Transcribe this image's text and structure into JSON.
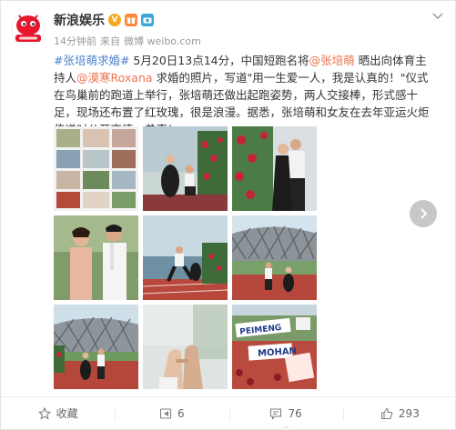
{
  "post": {
    "author": "新浪娱乐",
    "time": "14分钟前",
    "source_prefix": "来自",
    "source": "微博 weibo.com",
    "text": {
      "hashtag": "#张培萌求婚#",
      "p1": " 5月20日13点14分，中国短跑名将",
      "mention1": "@张培萌",
      "p2": " 晒出向体育主持人",
      "mention2": "@漠寒Roxana",
      "p3": " 求婚的照片，写道\"用一生爱一人，我是认真的！\"仪式在鸟巢前的跑道上举行，张培萌还做出起跑姿势，两人交接棒，形式感十足，现场还布置了红玫瑰，很是浪漫。据悉，张培萌和女友在去年亚运火炬传递时公开恋情。恭喜！"
    },
    "photo_text": {
      "sign1": "PEIMENG",
      "sign2": "MOHAN"
    }
  },
  "actions": {
    "favorite": "收藏",
    "repost": "6",
    "comment": "76",
    "like": "293"
  },
  "colors": {
    "link": "#eb7350",
    "accent_blue": "#4b7fc9",
    "brand_red": "#e6162d"
  },
  "icons": [
    "chevron-down-icon",
    "verified-v-icon",
    "gift-badge-icon",
    "camera-badge-icon",
    "next-arrow-icon",
    "star-icon",
    "repost-icon",
    "comment-icon",
    "like-icon"
  ]
}
